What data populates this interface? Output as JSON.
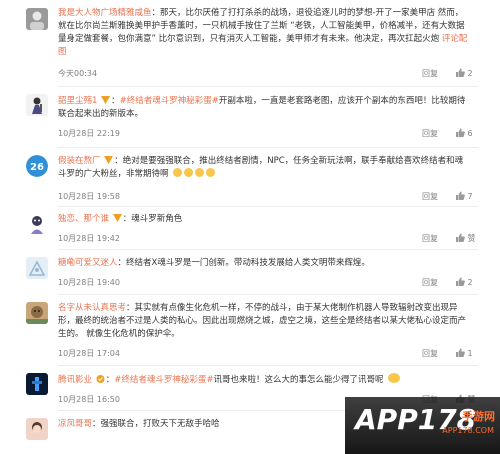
{
  "comments": [
    {
      "user": "我是大人物广场精雅咸鱼",
      "text": "那天，比尔厌倦了打打杀杀的战场，退役追逐儿时的梦想-开了一家美甲店 然而，就在比尔尚兰斯雅换美甲护手香薰时，一只机械手按住了兰斯 “老铁，人工智能美甲，价格减半，还有大数据量身定做套餐，包你满意” 比尔意识到，只有消灭人工智能，美甲师才有未来。他决定，再次扛起火炮",
      "link": "评论配图",
      "time": "今天00:34",
      "reply": "回复",
      "likes": "2"
    },
    {
      "user": "韶里尘殇1",
      "topic": "#终结者魂斗罗神秘彩蛋#",
      "text": "开副本啦，一直是老套路老图，应该开个副本的东西吧！比较期待联合起来出的新版本。",
      "time": "10月28日 22:19",
      "reply": "回复",
      "likes": "6"
    },
    {
      "user": "假装在熬厂",
      "text": "绝对是要强强联合，推出终结者剧情，NPC，任务全新玩法啊，联手奉献给喜欢终结者和魂斗罗的广大粉丝，非常期待啊",
      "time": "10月28日 19:58",
      "reply": "回复",
      "likes": "7"
    },
    {
      "user": "独恋、那个谁",
      "text": "魂斗罗新角色",
      "time": "10月28日 19:42",
      "reply": "回复",
      "likes": "赞"
    },
    {
      "user": "糖嘞可爱又迷人",
      "text": "终结者X魂斗罗是一门创新。带动科技发展给人类文明带来辉煌。",
      "time": "10月28日 19:40",
      "reply": "回复",
      "likes": "2"
    },
    {
      "user": "名字从未认真思考",
      "text": "其实就有点像生化危机一样，不停的战斗，由于某大佬制作机器人导致辐射改变出现异形，最终的统治者不过是人类的私心。因此出现燃烧之城，虚空之境，这些全是终结者以某大佬私心设定而产生的。 就像生化危机的保护伞。",
      "time": "10月28日 17:04",
      "reply": "回复",
      "likes": "1"
    },
    {
      "user": "腾讯影业",
      "topic": "#终结者魂斗罗神秘彩蛋#",
      "text": "讯哥也来啦！这么大的事怎么能少得了讯哥呢",
      "time": "10月28日 16:50",
      "reply": "回复",
      "likes": "赞"
    },
    {
      "user": "凉凤哥哥",
      "text": "强强联合，打败天下无敌手哈哈",
      "time": "",
      "reply": "",
      "likes": ""
    }
  ],
  "watermark": {
    "main": "APP178",
    "sub": "手游网",
    "domain": "APP178.COM"
  },
  "colors": {
    "username": "#eb7350",
    "meta": "#808080"
  }
}
